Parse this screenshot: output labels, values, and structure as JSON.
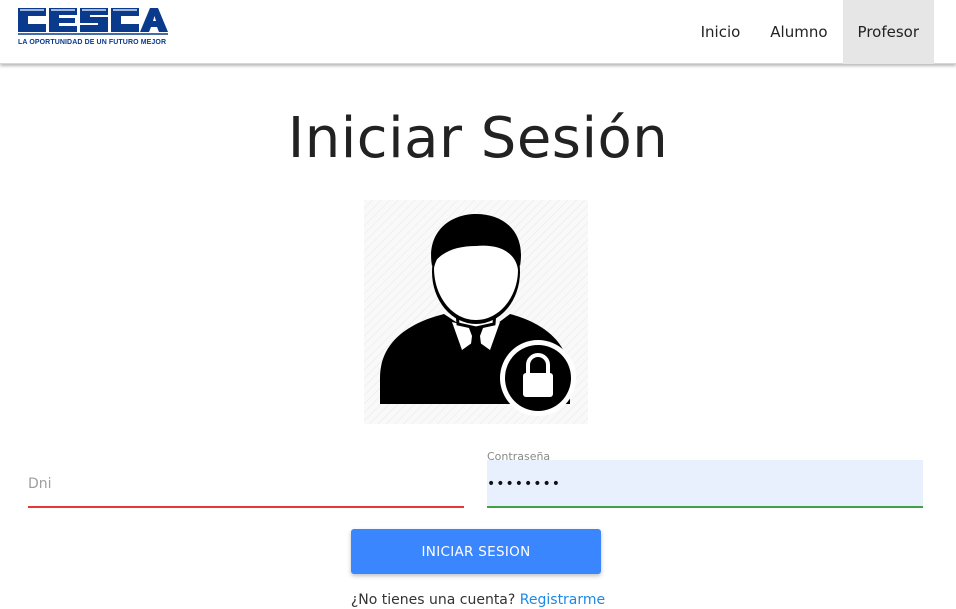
{
  "brand": {
    "logo_text": "CESCA",
    "tagline": "LA OPORTUNIDAD DE UN FUTURO MEJOR",
    "color": "#0a3a8c"
  },
  "nav": {
    "items": [
      {
        "label": "Inicio",
        "active": false
      },
      {
        "label": "Alumno",
        "active": false
      },
      {
        "label": "Profesor",
        "active": true
      }
    ]
  },
  "main": {
    "title": "Iniciar Sesión",
    "avatar_icon": "user-lock-icon"
  },
  "form": {
    "dni": {
      "placeholder": "Dni",
      "value": ""
    },
    "password": {
      "label": "Contraseña",
      "value": "••••••••"
    },
    "submit_label": "INICIAR SESION",
    "register_prompt": "¿No tienes una cuenta?",
    "register_link": "Registrarme"
  },
  "colors": {
    "primary": "#3a86ff",
    "error": "#e53935",
    "valid": "#43a047",
    "link": "#1e88e5",
    "autofill": "#e8f0fe"
  }
}
